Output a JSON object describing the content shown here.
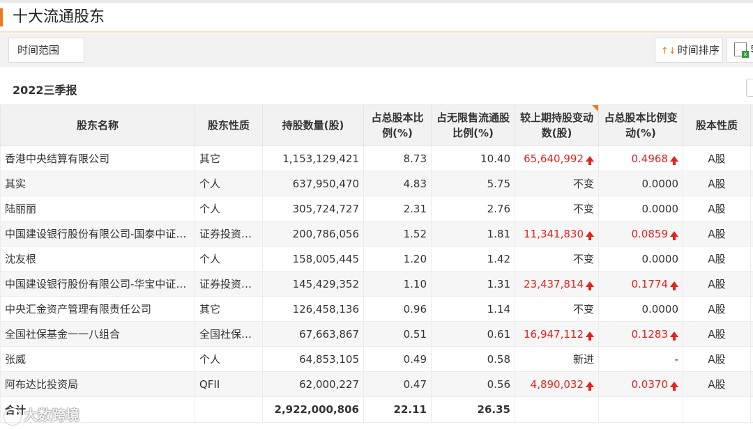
{
  "header": {
    "title": "十大流通股东"
  },
  "toolbar": {
    "range_label": "时间范围",
    "sort_label": "时间排序",
    "sort_icon": "↑↓",
    "export_label": "导"
  },
  "period": {
    "label": "2022三季报"
  },
  "table": {
    "columns": [
      "股东名称",
      "股东性质",
      "持股数量(股)",
      "占总股本比例(%)",
      "占无限售流通股比例(%)",
      "较上期持股变动数(股)",
      "占总股本比例变动(%)",
      "股本性质"
    ],
    "rows": [
      {
        "name": "香港中央结算有限公司",
        "type": "其它",
        "shares": "1,153,129,421",
        "pct_total": "8.73",
        "pct_float": "10.40",
        "change": "65,640,992",
        "change_up": true,
        "pct_change": "0.4968",
        "pct_up": true,
        "share_type": "A股"
      },
      {
        "name": "其实",
        "type": "个人",
        "shares": "637,950,470",
        "pct_total": "4.83",
        "pct_float": "5.75",
        "change": "不变",
        "change_up": false,
        "pct_change": "0.0000",
        "pct_up": false,
        "share_type": "A股"
      },
      {
        "name": "陆丽丽",
        "type": "个人",
        "shares": "305,724,727",
        "pct_total": "2.31",
        "pct_float": "2.76",
        "change": "不变",
        "change_up": false,
        "pct_change": "0.0000",
        "pct_up": false,
        "share_type": "A股"
      },
      {
        "name": "中国建设银行股份有限公司-国泰中证全指证券公司交易型开放式指数证券投资基金",
        "type": "证券投资基金",
        "shares": "200,786,056",
        "pct_total": "1.52",
        "pct_float": "1.81",
        "change": "11,341,830",
        "change_up": true,
        "pct_change": "0.0859",
        "pct_up": true,
        "share_type": "A股"
      },
      {
        "name": "沈友根",
        "type": "个人",
        "shares": "158,005,445",
        "pct_total": "1.20",
        "pct_float": "1.42",
        "change": "不变",
        "change_up": false,
        "pct_change": "0.0000",
        "pct_up": false,
        "share_type": "A股"
      },
      {
        "name": "中国建设银行股份有限公司-华宝中证全指证券公司交易型开放式指数证券投资基金",
        "type": "证券投资基金",
        "shares": "145,429,352",
        "pct_total": "1.10",
        "pct_float": "1.31",
        "change": "23,437,814",
        "change_up": true,
        "pct_change": "0.1774",
        "pct_up": true,
        "share_type": "A股"
      },
      {
        "name": "中央汇金资产管理有限责任公司",
        "type": "其它",
        "shares": "126,458,136",
        "pct_total": "0.96",
        "pct_float": "1.14",
        "change": "不变",
        "change_up": false,
        "pct_change": "0.0000",
        "pct_up": false,
        "share_type": "A股"
      },
      {
        "name": "全国社保基金一一八组合",
        "type": "全国社保基金",
        "shares": "67,663,867",
        "pct_total": "0.51",
        "pct_float": "0.61",
        "change": "16,947,112",
        "change_up": true,
        "pct_change": "0.1283",
        "pct_up": true,
        "share_type": "A股"
      },
      {
        "name": "张威",
        "type": "个人",
        "shares": "64,853,105",
        "pct_total": "0.49",
        "pct_float": "0.58",
        "change": "新进",
        "change_up": false,
        "pct_change": "-",
        "pct_up": false,
        "share_type": "A股"
      },
      {
        "name": "阿布达比投资局",
        "type": "QFII",
        "shares": "62,000,227",
        "pct_total": "0.47",
        "pct_float": "0.56",
        "change": "4,890,032",
        "change_up": true,
        "pct_change": "0.0370",
        "pct_up": true,
        "share_type": "A股"
      }
    ],
    "total": {
      "label": "合计",
      "shares": "2,922,000,806",
      "pct_total": "22.11",
      "pct_float": "26.35"
    }
  },
  "watermark": {
    "text": "大数跨境"
  },
  "colors": {
    "accent": "#f0781e",
    "up_red": "#e3231f",
    "header_bg": "#f2f2f2"
  }
}
